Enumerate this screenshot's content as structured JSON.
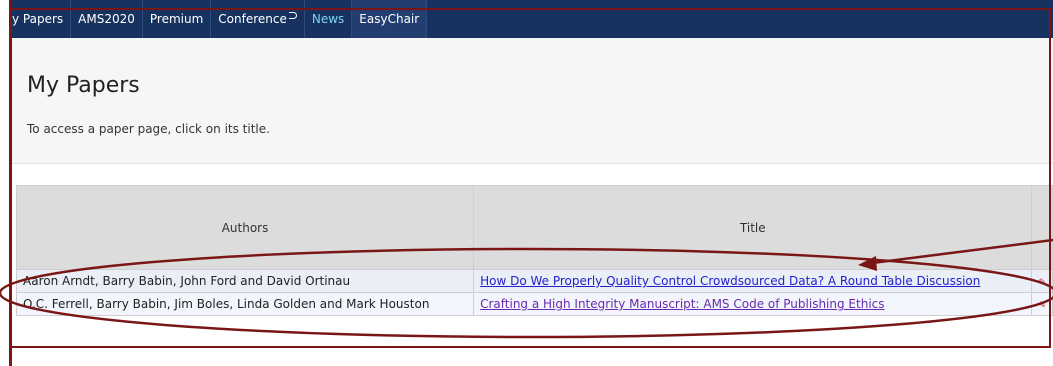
{
  "nav": {
    "tabs": [
      {
        "label": "y Papers"
      },
      {
        "label": "AMS2020"
      },
      {
        "label": "Premium"
      },
      {
        "label": "Conference"
      },
      {
        "label": "News"
      },
      {
        "label": "EasyChair"
      }
    ]
  },
  "page": {
    "title": "My Papers",
    "hint": "To access a paper page, click on its title."
  },
  "table": {
    "columns": {
      "authors": "Authors",
      "title": "Title"
    },
    "rows": [
      {
        "authors": "Aaron Arndt, Barry Babin, John Ford and David Ortinau",
        "title": "How Do We Properly Quality Control Crowdsourced Data? A Round Table Discussion"
      },
      {
        "authors": "O.C. Ferrell, Barry Babin, Jim Boles, Linda Golden and Mark Houston",
        "title": "Crafting a High Integrity Manuscript: AMS Code of Publishing Ethics"
      }
    ]
  },
  "colors": {
    "navbar": "#17325e",
    "annotation": "#7a1616",
    "link": "#2222cc",
    "link_visited": "#6a2bb0",
    "news_tab": "#7fd3f5"
  },
  "icons": [
    "external-link-icon",
    "edit-icon"
  ]
}
